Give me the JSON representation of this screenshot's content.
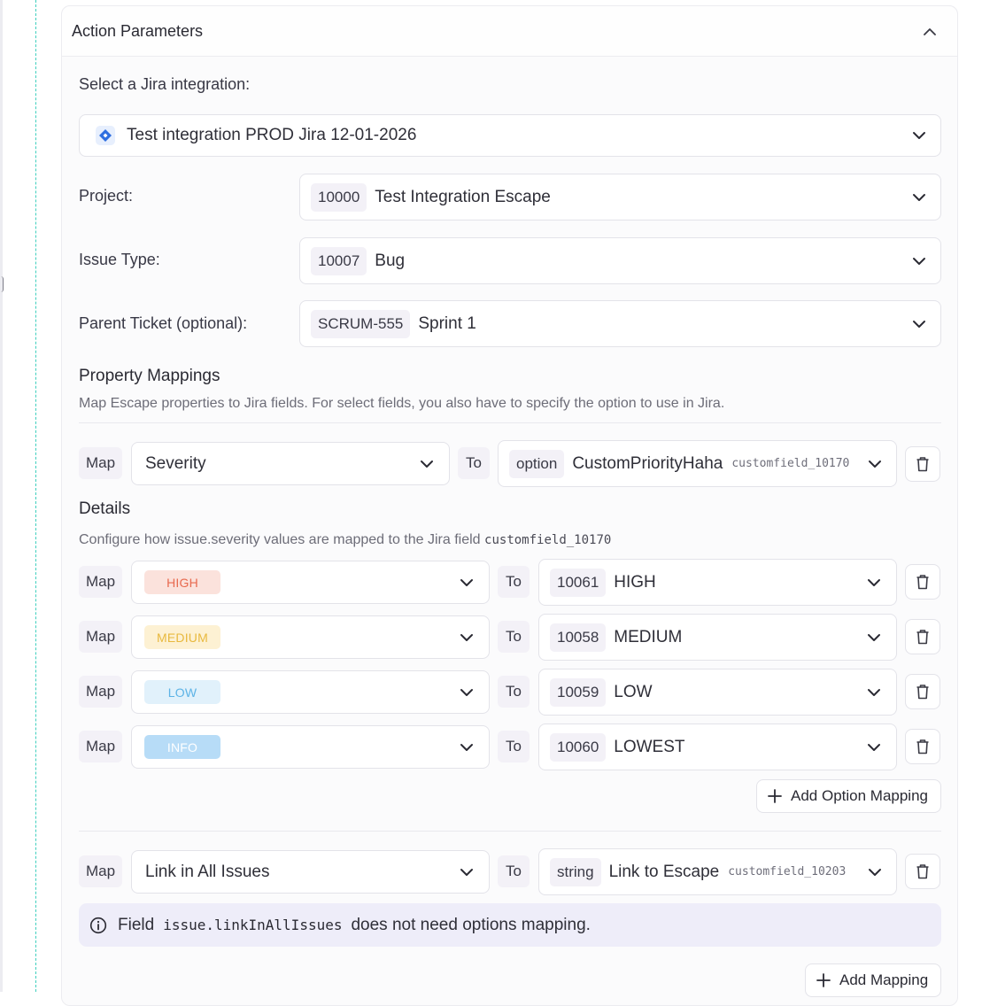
{
  "panel": {
    "title": "Action Parameters"
  },
  "integration": {
    "label": "Select a Jira integration:",
    "value": "Test integration PROD Jira 12-01-2026",
    "icon": "jira-diamond-icon",
    "icon_color": "#2f6fe0"
  },
  "project": {
    "label": "Project:",
    "id": "10000",
    "name": "Test Integration Escape"
  },
  "issue_type": {
    "label": "Issue Type:",
    "id": "10007",
    "name": "Bug"
  },
  "parent": {
    "label": "Parent Ticket (optional):",
    "id": "SCRUM-555",
    "name": "Sprint 1"
  },
  "property_mappings": {
    "title": "Property Mappings",
    "description": "Map Escape properties to Jira fields. For select fields, you also have to specify the option to use in Jira."
  },
  "mapping1": {
    "map_label": "Map",
    "source": "Severity",
    "to_label": "To",
    "target_type": "option",
    "target_name": "CustomPriorityHaha",
    "target_field": "customfield_10170"
  },
  "details": {
    "title": "Details",
    "description_prefix": "Configure how issue.severity values are mapped to the Jira field",
    "field_code": "customfield_10170"
  },
  "option_mappings": [
    {
      "map_label": "Map",
      "severity": "HIGH",
      "color": "#e8694e",
      "bg": "#fbe2dc",
      "to_label": "To",
      "id": "10061",
      "name": "HIGH"
    },
    {
      "map_label": "Map",
      "severity": "MEDIUM",
      "color": "#e8b93e",
      "bg": "#fdf1d3",
      "to_label": "To",
      "id": "10058",
      "name": "MEDIUM"
    },
    {
      "map_label": "Map",
      "severity": "LOW",
      "color": "#5db3e6",
      "bg": "#e1f1fb",
      "to_label": "To",
      "id": "10059",
      "name": "LOW"
    },
    {
      "map_label": "Map",
      "severity": "INFO",
      "color": "#ffffff",
      "bg": "#b7dcf7",
      "to_label": "To",
      "id": "10060",
      "name": "LOWEST"
    }
  ],
  "add_option_mapping": "Add Option Mapping",
  "mapping2": {
    "map_label": "Map",
    "source": "Link in All Issues",
    "to_label": "To",
    "target_type": "string",
    "target_name": "Link to Escape",
    "target_field": "customfield_10203"
  },
  "info": {
    "prefix": "Field",
    "code": "issue.linkInAllIssues",
    "suffix": "does not need options mapping."
  },
  "add_mapping": "Add Mapping"
}
